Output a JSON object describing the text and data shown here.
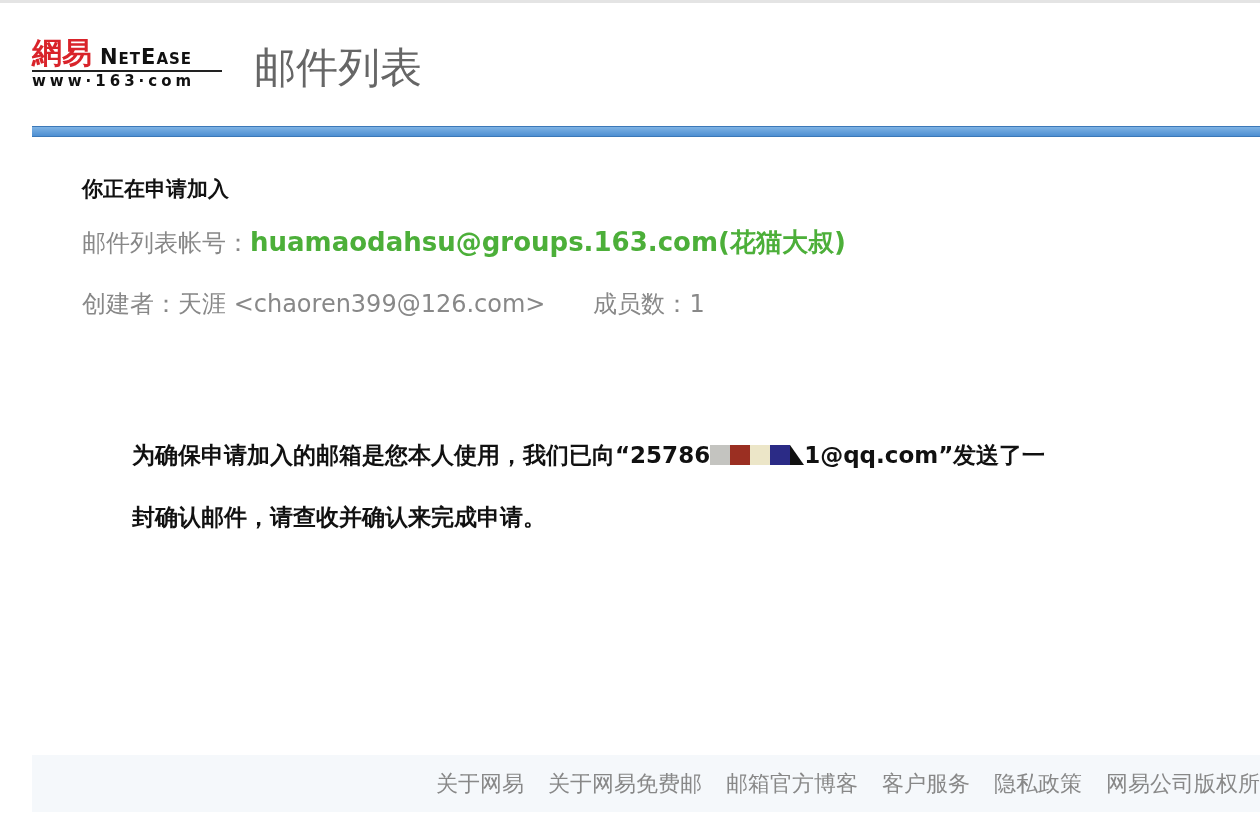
{
  "logo": {
    "mark": "網易",
    "brand": "NetEase",
    "site": "www·163·com"
  },
  "page_title": "邮件列表",
  "heading": "你正在申请加入",
  "list_account": {
    "label": "邮件列表帐号：",
    "value": "huamaodahsu@groups.163.com(花猫大叔)"
  },
  "creator": {
    "label": "创建者：",
    "value": "天涯 <chaoren399@126.com>"
  },
  "members": {
    "label": "成员数：",
    "value": "1"
  },
  "notice": {
    "before": "为确保申请加入的邮箱是您本人使用，我们已向“25786",
    "after": "1@qq.com”发送了一",
    "line2": "封确认邮件，请查收并确认来完成申请。"
  },
  "footer_links": [
    "关于网易",
    "关于网易免费邮",
    "邮箱官方博客",
    "客户服务",
    "隐私政策",
    "网易公司版权所"
  ]
}
